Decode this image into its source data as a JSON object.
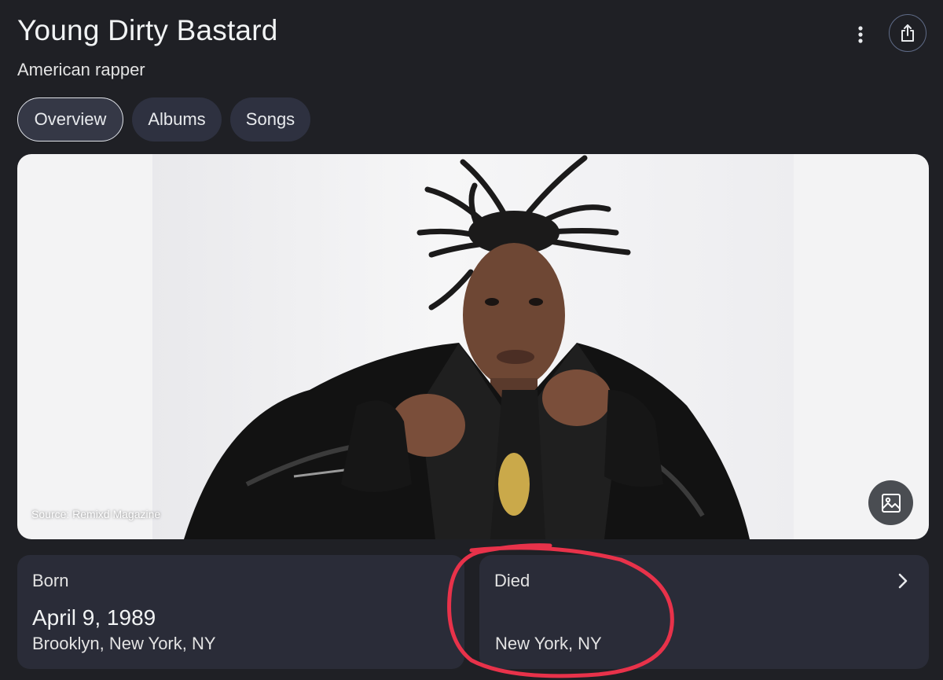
{
  "entity": {
    "title": "Young Dirty Bastard",
    "subtitle": "American rapper"
  },
  "tabs": [
    {
      "label": "Overview",
      "active": true
    },
    {
      "label": "Albums",
      "active": false
    },
    {
      "label": "Songs",
      "active": false
    }
  ],
  "photo": {
    "source_caption": "Source: Remixd Magazine"
  },
  "born": {
    "label": "Born",
    "date": "April 9, 1989",
    "place": "Brooklyn, New York, NY"
  },
  "died": {
    "label": "Died",
    "place": "New York, NY"
  },
  "icons": {
    "more": "more-vert-icon",
    "share": "share-icon",
    "images": "image-icon",
    "expand": "chevron-right-icon"
  },
  "colors": {
    "background": "#1f2025",
    "chip_background": "#2e3140",
    "card_background": "#2a2c38",
    "annotation_red": "#e8324a"
  }
}
